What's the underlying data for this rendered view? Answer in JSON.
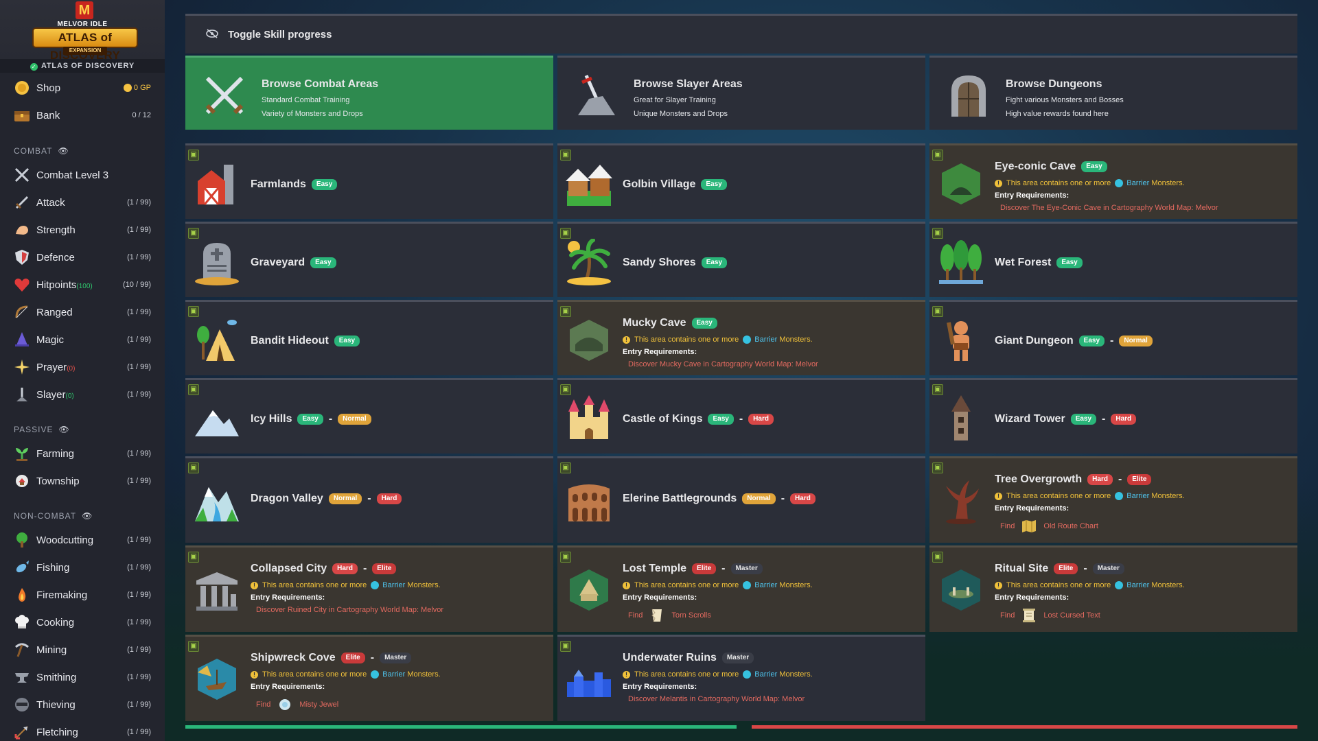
{
  "sidebar": {
    "logo": {
      "brand": "MELVOR IDLE",
      "title": "ATLAS of DISCOVERY",
      "expansion": "EXPANSION",
      "m": "M"
    },
    "expansion_label": "ATLAS OF DISCOVERY",
    "shop": {
      "label": "Shop",
      "gp": "0 GP"
    },
    "bank": {
      "label": "Bank",
      "count": "0 / 12"
    },
    "combat_header": "COMBAT",
    "combat": [
      {
        "label": "Combat Level 3",
        "sub": "",
        "level": ""
      },
      {
        "label": "Attack",
        "sub": "",
        "level": "(1 / 99)"
      },
      {
        "label": "Strength",
        "sub": "",
        "level": "(1 / 99)"
      },
      {
        "label": "Defence",
        "sub": "",
        "level": "(1 / 99)"
      },
      {
        "label": "Hitpoints",
        "sub": "(100)",
        "level": "(10 / 99)"
      },
      {
        "label": "Ranged",
        "sub": "",
        "level": "(1 / 99)"
      },
      {
        "label": "Magic",
        "sub": "",
        "level": "(1 / 99)"
      },
      {
        "label": "Prayer",
        "sub": "(0)",
        "level": "(1 / 99)"
      },
      {
        "label": "Slayer",
        "sub": "(0)",
        "level": "(1 / 99)"
      }
    ],
    "passive_header": "PASSIVE",
    "passive": [
      {
        "label": "Farming",
        "level": "(1 / 99)"
      },
      {
        "label": "Township",
        "level": "(1 / 99)"
      }
    ],
    "noncombat_header": "NON-COMBAT",
    "noncombat": [
      {
        "label": "Woodcutting",
        "level": "(1 / 99)"
      },
      {
        "label": "Fishing",
        "level": "(1 / 99)"
      },
      {
        "label": "Firemaking",
        "level": "(1 / 99)"
      },
      {
        "label": "Cooking",
        "level": "(1 / 99)"
      },
      {
        "label": "Mining",
        "level": "(1 / 99)"
      },
      {
        "label": "Smithing",
        "level": "(1 / 99)"
      },
      {
        "label": "Thieving",
        "level": "(1 / 99)"
      },
      {
        "label": "Fletching",
        "level": "(1 / 99)"
      }
    ]
  },
  "toggle_label": "Toggle Skill progress",
  "browse": [
    {
      "title": "Browse Combat Areas",
      "line1": "Standard Combat Training",
      "line2": "Variety of Monsters and Drops"
    },
    {
      "title": "Browse Slayer Areas",
      "line1": "Great for Slayer Training",
      "line2": "Unique Monsters and Drops"
    },
    {
      "title": "Browse Dungeons",
      "line1": "Fight various Monsters and Bosses",
      "line2": "High value rewards found here"
    }
  ],
  "common": {
    "note_prefix": "This area contains one or more",
    "barrier": "Barrier",
    "monsters": "Monsters.",
    "entry": "Entry Requirements:",
    "find": "Find",
    "dash": "-"
  },
  "areas": {
    "farmlands": {
      "title": "Farmlands",
      "badges": [
        "Easy"
      ]
    },
    "golbin": {
      "title": "Golbin Village",
      "badges": [
        "Easy"
      ]
    },
    "eyeconic": {
      "title": "Eye-conic Cave",
      "badges": [
        "Easy"
      ],
      "req": "Discover The Eye-Conic Cave in Cartography World Map: Melvor"
    },
    "graveyard": {
      "title": "Graveyard",
      "badges": [
        "Easy"
      ]
    },
    "sandy": {
      "title": "Sandy Shores",
      "badges": [
        "Easy"
      ]
    },
    "wetforest": {
      "title": "Wet Forest",
      "badges": [
        "Easy"
      ]
    },
    "bandit": {
      "title": "Bandit Hideout",
      "badges": [
        "Easy"
      ]
    },
    "mucky": {
      "title": "Mucky Cave",
      "badges": [
        "Easy"
      ],
      "req": "Discover Mucky Cave in Cartography World Map: Melvor"
    },
    "giant": {
      "title": "Giant Dungeon",
      "badges": [
        "Easy",
        "Normal"
      ]
    },
    "icy": {
      "title": "Icy Hills",
      "badges": [
        "Easy",
        "Normal"
      ]
    },
    "castle": {
      "title": "Castle of Kings",
      "badges": [
        "Easy",
        "Hard"
      ]
    },
    "wizard": {
      "title": "Wizard Tower",
      "badges": [
        "Easy",
        "Hard"
      ]
    },
    "dragon": {
      "title": "Dragon Valley",
      "badges": [
        "Normal",
        "Hard"
      ]
    },
    "elerine": {
      "title": "Elerine Battlegrounds",
      "badges": [
        "Normal",
        "Hard"
      ]
    },
    "tree": {
      "title": "Tree Overgrowth",
      "badges": [
        "Hard",
        "Elite"
      ],
      "find_item": "Old Route Chart"
    },
    "collapsed": {
      "title": "Collapsed City",
      "badges": [
        "Hard",
        "Elite"
      ],
      "req": "Discover Ruined City in Cartography World Map: Melvor"
    },
    "lost": {
      "title": "Lost Temple",
      "badges": [
        "Elite",
        "Master"
      ],
      "find_item": "Torn Scrolls"
    },
    "ritual": {
      "title": "Ritual Site",
      "badges": [
        "Elite",
        "Master"
      ],
      "find_item": "Lost Cursed Text"
    },
    "shipwreck": {
      "title": "Shipwreck Cove",
      "badges": [
        "Elite",
        "Master"
      ],
      "find_item": "Misty Jewel"
    },
    "underwater": {
      "title": "Underwater Ruins",
      "badges": [
        "Master"
      ],
      "req": "Discover Melantis in Cartography World Map: Melvor"
    }
  },
  "colors": {
    "easy": "#2ab67a",
    "normal": "#e0a43a",
    "hard": "#d84747",
    "active_green": "#2e8a4f",
    "barrier": "#4fc6ef"
  }
}
